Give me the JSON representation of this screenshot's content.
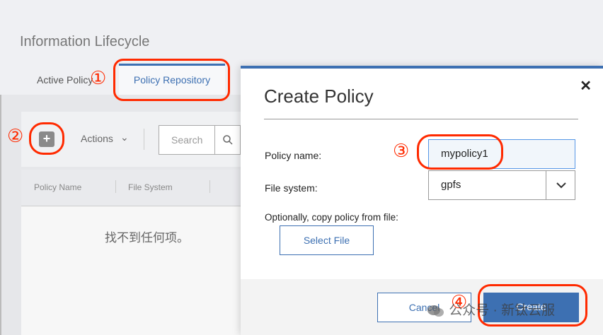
{
  "app": {
    "title": "Information Lifecycle",
    "tabs": [
      {
        "label": "Active Policy"
      },
      {
        "label": "Policy Repository"
      }
    ]
  },
  "toolbar": {
    "add_icon": "plus-icon",
    "actions_label": "Actions",
    "search_placeholder": "Search"
  },
  "table": {
    "columns": [
      "Policy Name",
      "File System"
    ],
    "empty_message": "找不到任何项。"
  },
  "modal": {
    "title": "Create Policy",
    "close_glyph": "✕",
    "policy_name_label": "Policy name:",
    "policy_name_value": "mypolicy1",
    "file_system_label": "File system:",
    "file_system_value": "gpfs",
    "copy_label": "Optionally, copy policy from file:",
    "select_file_label": "Select File",
    "cancel_label": "Cancel",
    "create_label": "Create"
  },
  "annotations": {
    "markers": [
      "①",
      "②",
      "③",
      "④"
    ],
    "color": "#ff2a00"
  },
  "watermark": {
    "text": "公众号 · 新钛云服"
  },
  "colors": {
    "accent": "#3d70b2"
  }
}
